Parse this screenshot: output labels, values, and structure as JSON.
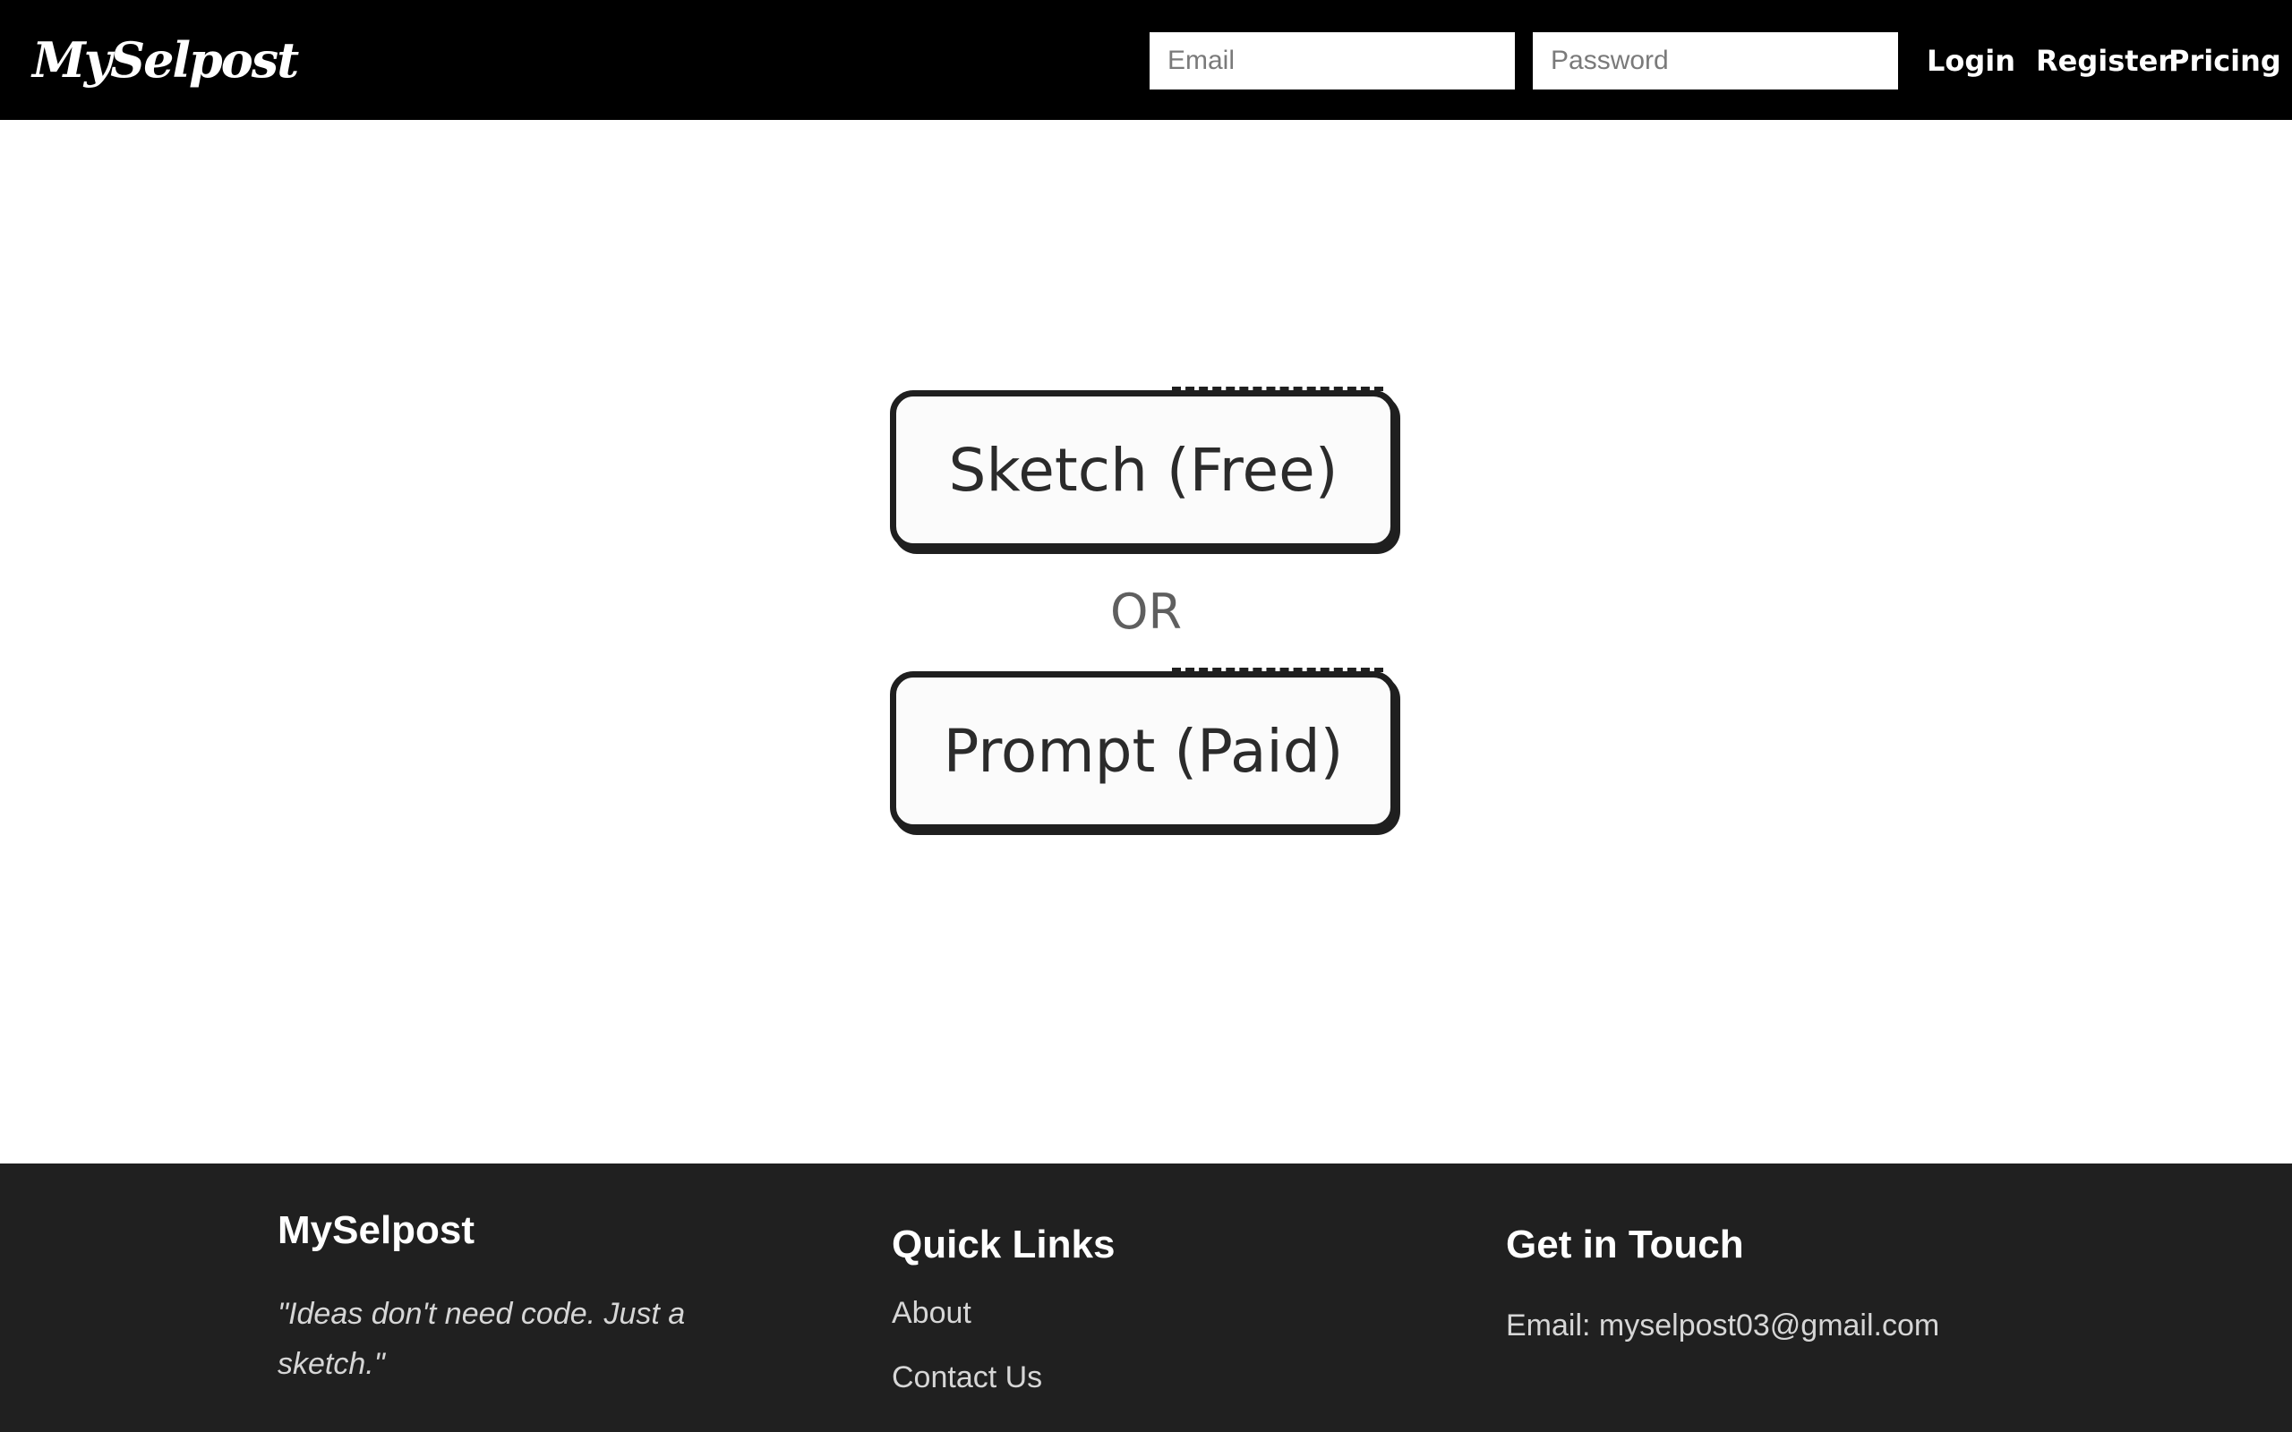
{
  "header": {
    "logo": "MySelpost",
    "email_placeholder": "Email",
    "password_placeholder": "Password",
    "nav": {
      "login": "Login",
      "register": "Register",
      "pricing": "Pricing"
    }
  },
  "main": {
    "sketch_button": "Sketch (Free)",
    "or_label": "OR",
    "prompt_button": "Prompt (Paid)"
  },
  "footer": {
    "brand": "MySelpost",
    "tagline": "\"Ideas don't need code. Just a sketch.\"",
    "quick_links": {
      "heading": "Quick Links",
      "about": "About",
      "contact": "Contact Us"
    },
    "contact": {
      "heading": "Get in Touch",
      "email": "Email: myselpost03@gmail.com"
    }
  },
  "colors": {
    "header_bg": "#000000",
    "footer_bg": "#202020",
    "button_border": "#1f1f1f"
  }
}
